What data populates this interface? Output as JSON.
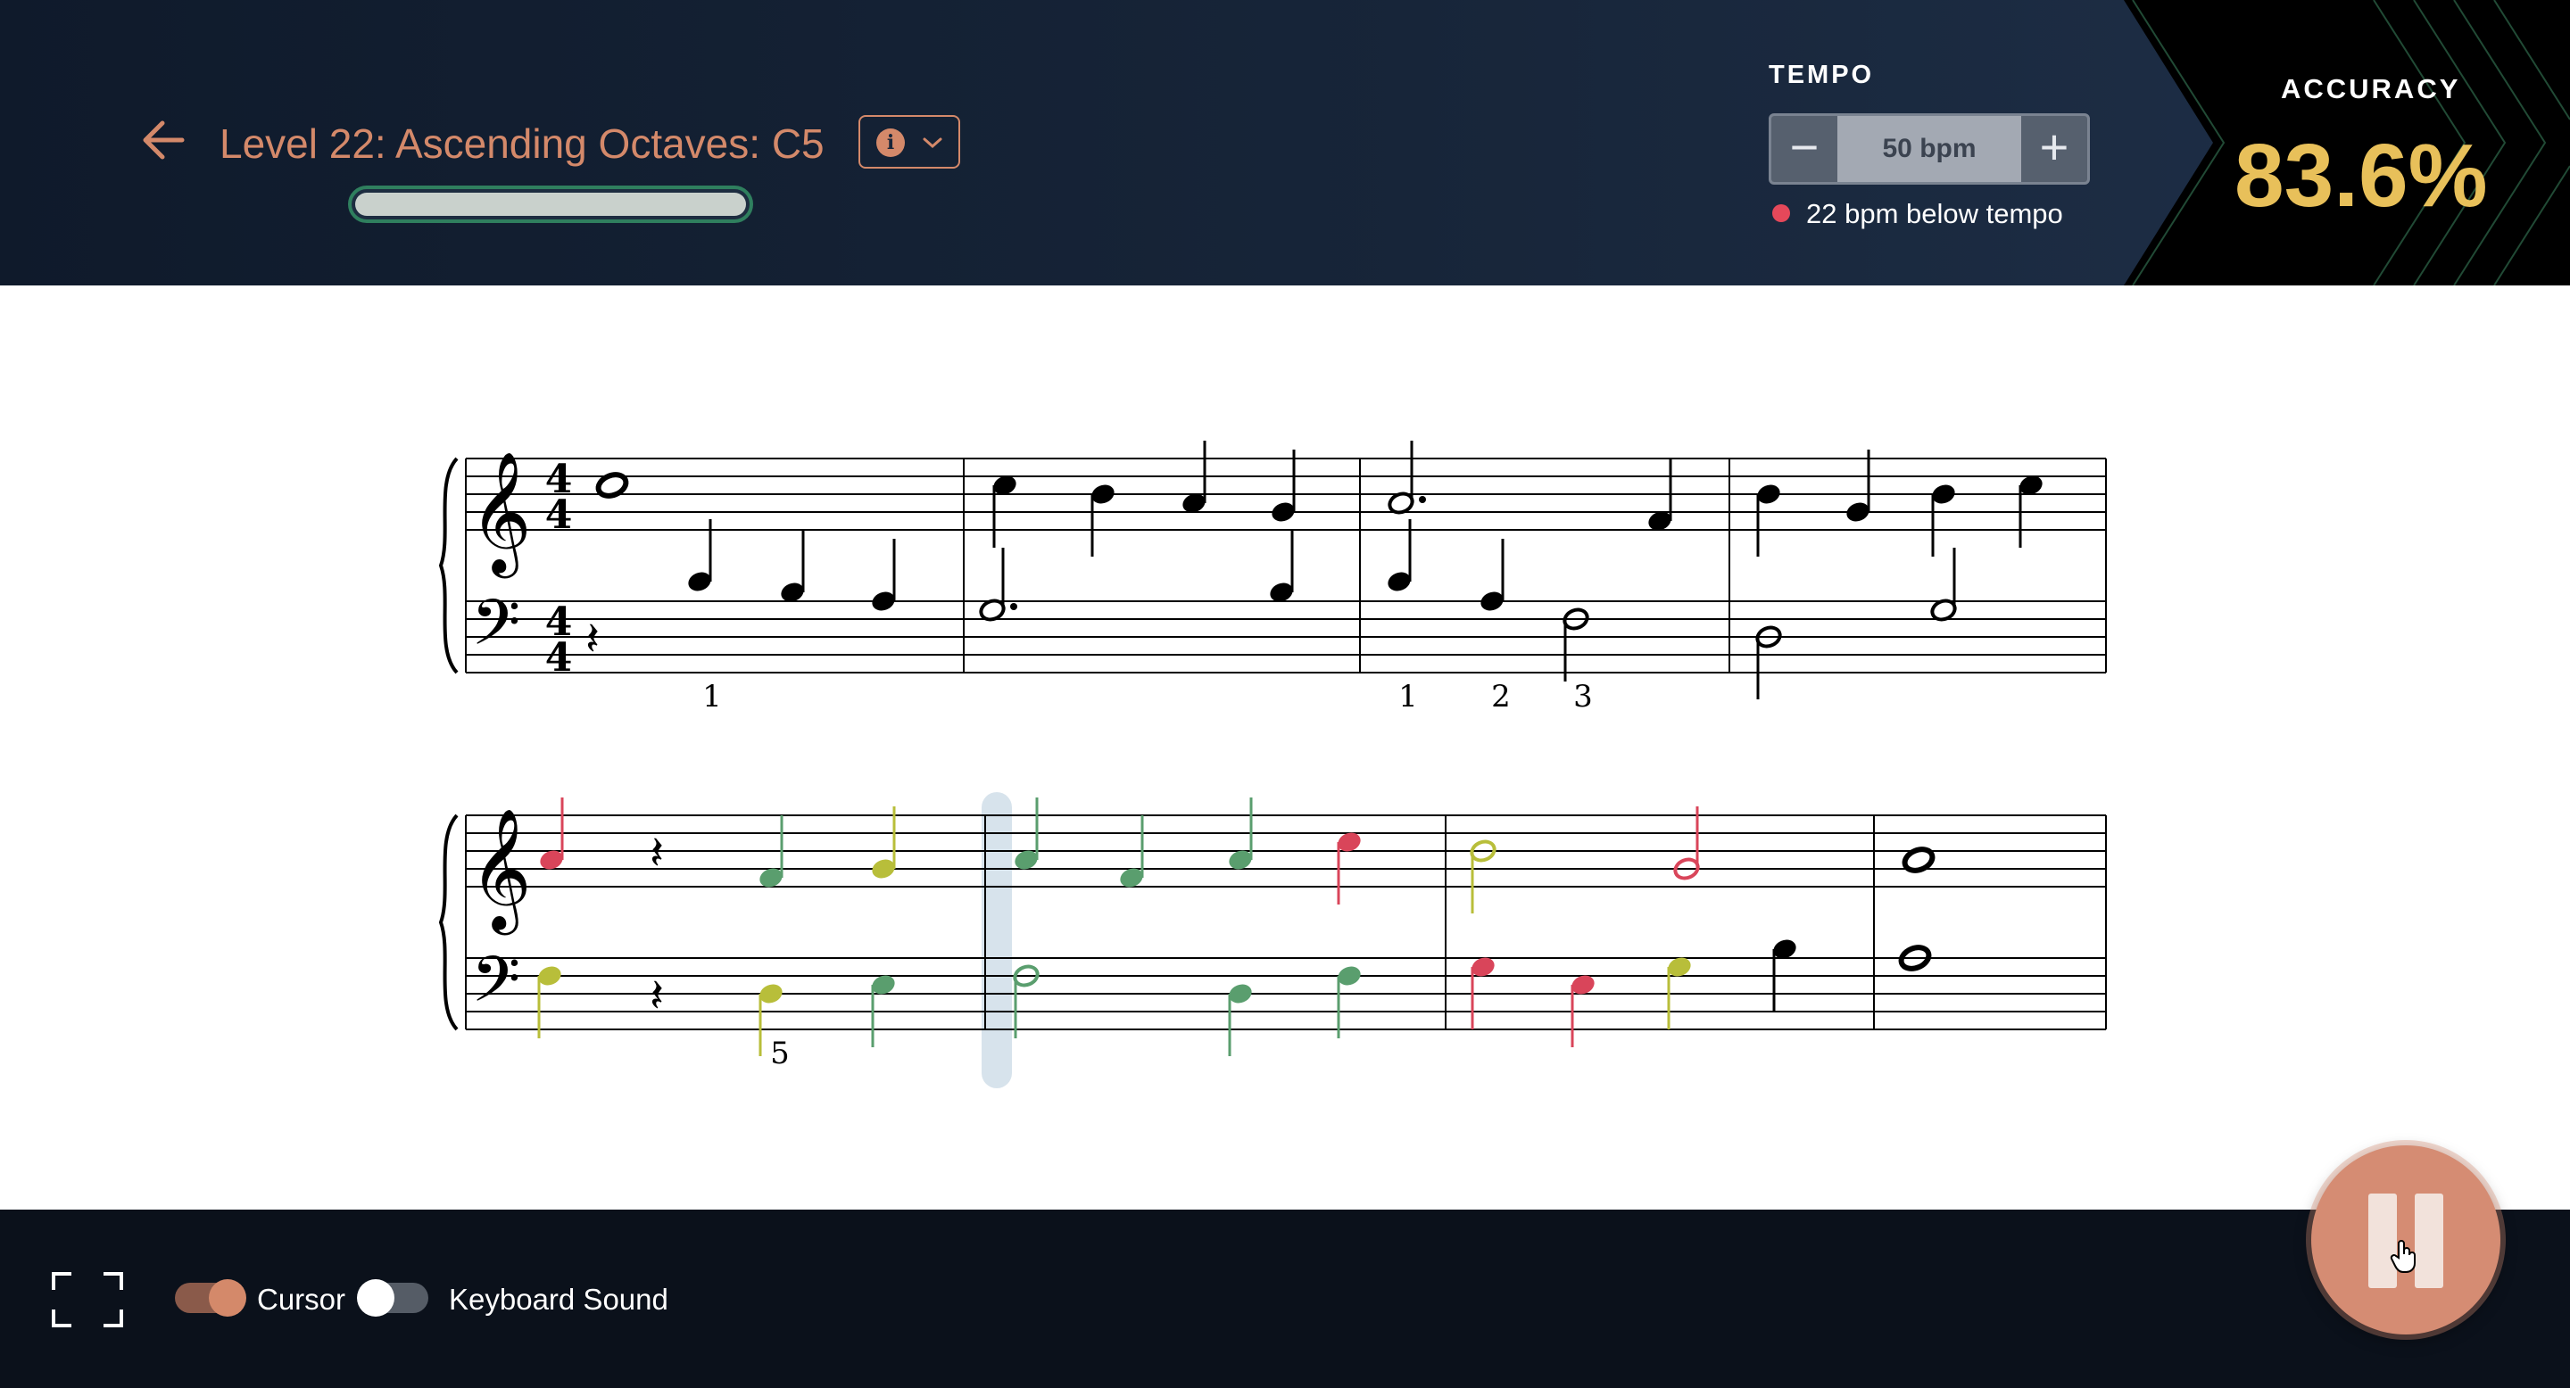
{
  "header": {
    "title": "Level 22: Ascending Octaves: C5",
    "progress_fraction": 1.0,
    "info_glyph": "i",
    "back_icon": "arrow-left-icon"
  },
  "tempo": {
    "label": "TEMPO",
    "value": "50 bpm",
    "minus": "−",
    "plus": "+",
    "status": "22 bpm below tempo",
    "status_color": "#e5485a"
  },
  "accuracy": {
    "label": "ACCURACY",
    "value": "83.6%",
    "value_color": "#e8c05a"
  },
  "score": {
    "time_signature": [
      "4",
      "4"
    ],
    "fingerings": [
      "1",
      "1",
      "2",
      "3",
      "5"
    ],
    "note_colors": {
      "correct": "#5a9e6e",
      "near": "#b8be3a",
      "wrong": "#d9455a",
      "unplayed": "#000000"
    }
  },
  "footer": {
    "cursor_label": "Cursor",
    "cursor_on": true,
    "keyboard_sound_label": "Keyboard Sound",
    "keyboard_sound_on": false
  },
  "colors": {
    "accent": "#d4896a",
    "header_bg": "#172539",
    "footer_bg": "#0b111b"
  }
}
